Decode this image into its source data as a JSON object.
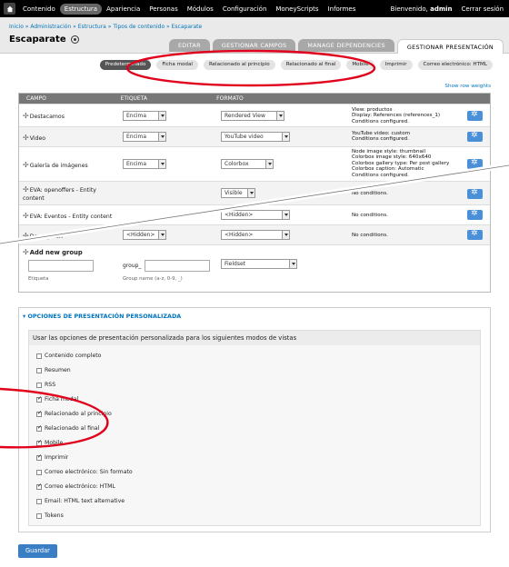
{
  "toolbar": {
    "menu": [
      "Contenido",
      "Estructura",
      "Apariencia",
      "Personas",
      "Módulos",
      "Configuración",
      "MoneyScripts",
      "Informes"
    ],
    "active_index": 1,
    "welcome_prefix": "Bienvenido,",
    "user": "admin",
    "logout": "Cerrar sesión"
  },
  "breadcrumb": "Inicio » Administración » Estructura » Tipos de contenido » Escaparate",
  "page_title": "Escaparate",
  "tabs": [
    "EDITAR",
    "GESTIONAR CAMPOS",
    "MANAGE DEPENDENCIES",
    "GESTIONAR PRESENTACIÓN"
  ],
  "subtabs": [
    "Predeterminado",
    "Ficha modal",
    "Relacionado al principio",
    "Relacionado al final",
    "Mobile",
    "Imprimir",
    "Correo electrónico: HTML"
  ],
  "show_row_weights": "Show row weights",
  "table": {
    "headers": [
      "CAMPO",
      "ETIQUETA",
      "FORMATO"
    ],
    "rows": [
      {
        "name": "Destacamos",
        "label": "Encima",
        "format": "Rendered View",
        "summary": [
          "View: productos",
          "Display: References (references_1)",
          "Conditions configured."
        ]
      },
      {
        "name": "Video",
        "label": "Encima",
        "format": "YouTube video",
        "summary": [
          "YouTube video: custom",
          "Conditions configured."
        ]
      },
      {
        "name": "Galería de imágenes",
        "label": "Encima",
        "format": "Colorbox",
        "summary": [
          "Node image style: thumbnail",
          "Colorbox image style: 640x640",
          "Colorbox gallery type: Per post gallery",
          "Colorbox caption: Automatic",
          "Conditions configured."
        ]
      },
      {
        "name": "EVA: openoffers - Entity content",
        "label": "",
        "format": "Visible",
        "summary": [
          "No conditions."
        ]
      },
      {
        "name": "EVA: Eventos - Entity content",
        "label": "",
        "format": "<Hidden>",
        "summary": [
          "No conditions."
        ]
      },
      {
        "name": "Descripción",
        "label": "<Hidden>",
        "format": "<Hidden>",
        "summary": [
          "No conditions."
        ]
      }
    ],
    "add_group": {
      "title": "Add new group",
      "label_hint": "Etiqueta",
      "prefix": "group_",
      "name_hint": "Group name (a-z, 0-9, _)",
      "format": "Fieldset"
    }
  },
  "options": {
    "legend": "OPCIONES DE PRESENTACIÓN PERSONALIZADA",
    "box_title": "Usar las opciones de presentación personalizada para los siguientes modos de vistas",
    "items": [
      {
        "label": "Contenido completo",
        "checked": false
      },
      {
        "label": "Resumen",
        "checked": false
      },
      {
        "label": "RSS",
        "checked": false
      },
      {
        "label": "Ficha modal",
        "checked": true
      },
      {
        "label": "Relacionado al principio",
        "checked": true
      },
      {
        "label": "Relacionado al final",
        "checked": true
      },
      {
        "label": "Mobile",
        "checked": true
      },
      {
        "label": "Imprimir",
        "checked": true
      },
      {
        "label": "Correo electrónico: Sin formato",
        "checked": false
      },
      {
        "label": "Correo electrónico: HTML",
        "checked": true
      },
      {
        "label": "Email: HTML text alternative",
        "checked": false
      },
      {
        "label": "Tokens",
        "checked": false
      }
    ]
  },
  "save_label": "Guardar",
  "colors": {
    "accent": "#0074bd",
    "annotation": "#e0001b",
    "button": "#4a90d9"
  }
}
